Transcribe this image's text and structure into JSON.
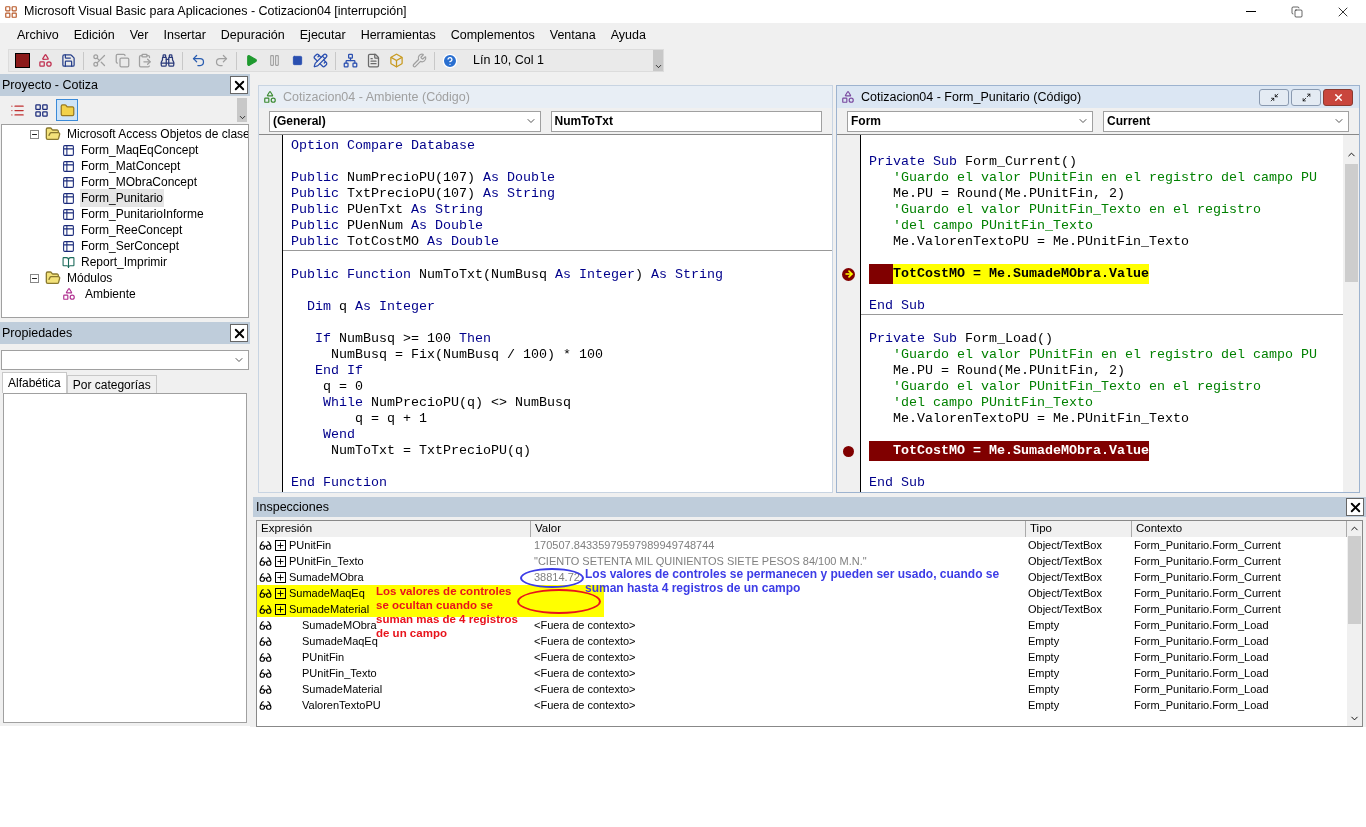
{
  "window": {
    "title": "Microsoft Visual Basic para Aplicaciones - Cotizacion04 [interrupción]"
  },
  "menu": [
    "Archivo",
    "Edición",
    "Ver",
    "Insertar",
    "Depuración",
    "Ejecutar",
    "Herramientas",
    "Complementos",
    "Ventana",
    "Ayuda"
  ],
  "toolbar": {
    "position": "Lín 10, Col 1"
  },
  "project": {
    "title": "Proyecto - Cotiza",
    "tree": [
      {
        "label": "Microsoft Access Objetos de clase",
        "kind": "folder",
        "expanded": true,
        "selected": false,
        "children": [
          {
            "label": "Form_MaqEqConcept",
            "kind": "form",
            "selected": false
          },
          {
            "label": "Form_MatConcept",
            "kind": "form",
            "selected": false
          },
          {
            "label": "Form_MObraConcept",
            "kind": "form",
            "selected": false
          },
          {
            "label": "Form_Punitario",
            "kind": "form",
            "selected": true
          },
          {
            "label": "Form_PunitarioInforme",
            "kind": "form",
            "selected": false
          },
          {
            "label": "Form_ReeConcept",
            "kind": "form",
            "selected": false
          },
          {
            "label": "Form_SerConcept",
            "kind": "form",
            "selected": false
          },
          {
            "label": "Report_Imprimir",
            "kind": "report",
            "selected": false
          }
        ]
      },
      {
        "label": "Módulos",
        "kind": "folder",
        "expanded": true,
        "selected": false,
        "children": [
          {
            "label": "Ambiente",
            "kind": "module",
            "selected": false
          }
        ]
      }
    ]
  },
  "properties": {
    "title": "Propiedades",
    "tabs": [
      {
        "label": "Alfabética",
        "selected": true
      },
      {
        "label": "Por categorías",
        "selected": false
      }
    ]
  },
  "code_windows": [
    {
      "title": "Cotizacion04 - Ambiente (Código)",
      "active": false,
      "object": "(General)",
      "procedure": "NumToTxt",
      "procedures": [
        {
          "lines": [
            {
              "kind": "code",
              "segments": [
                {
                  "kind": "keyword",
                  "text": "Option Compare Database"
                }
              ]
            },
            {
              "kind": "blank"
            },
            {
              "kind": "code",
              "segments": [
                {
                  "kind": "keyword",
                  "text": "Public "
                },
                {
                  "kind": "plain",
                  "text": "NumPrecioPU(107) "
                },
                {
                  "kind": "keyword",
                  "text": "As Double"
                }
              ]
            },
            {
              "kind": "code",
              "segments": [
                {
                  "kind": "keyword",
                  "text": "Public "
                },
                {
                  "kind": "plain",
                  "text": "TxtPrecioPU(107) "
                },
                {
                  "kind": "keyword",
                  "text": "As String"
                }
              ]
            },
            {
              "kind": "code",
              "segments": [
                {
                  "kind": "keyword",
                  "text": "Public "
                },
                {
                  "kind": "plain",
                  "text": "PUenTxt "
                },
                {
                  "kind": "keyword",
                  "text": "As String"
                }
              ]
            },
            {
              "kind": "code",
              "segments": [
                {
                  "kind": "keyword",
                  "text": "Public "
                },
                {
                  "kind": "plain",
                  "text": "PUenNum "
                },
                {
                  "kind": "keyword",
                  "text": "As Double"
                }
              ]
            },
            {
              "kind": "code",
              "segments": [
                {
                  "kind": "keyword",
                  "text": "Public "
                },
                {
                  "kind": "plain",
                  "text": "TotCostMO "
                },
                {
                  "kind": "keyword",
                  "text": "As Double"
                }
              ]
            }
          ]
        },
        {
          "lines": [
            {
              "kind": "blank"
            },
            {
              "kind": "code",
              "segments": [
                {
                  "kind": "keyword",
                  "text": "Public Function "
                },
                {
                  "kind": "plain",
                  "text": "NumToTxt(NumBusq "
                },
                {
                  "kind": "keyword",
                  "text": "As Integer"
                },
                {
                  "kind": "plain",
                  "text": ") "
                },
                {
                  "kind": "keyword",
                  "text": "As String"
                }
              ]
            },
            {
              "kind": "blank"
            },
            {
              "kind": "code",
              "segments": [
                {
                  "kind": "keyword",
                  "text": "  Dim "
                },
                {
                  "kind": "plain",
                  "text": "q "
                },
                {
                  "kind": "keyword",
                  "text": "As Integer"
                }
              ]
            },
            {
              "kind": "blank"
            },
            {
              "kind": "code",
              "segments": [
                {
                  "kind": "keyword",
                  "text": "   If "
                },
                {
                  "kind": "plain",
                  "text": "NumBusq >= 100 "
                },
                {
                  "kind": "keyword",
                  "text": "Then"
                }
              ]
            },
            {
              "kind": "code",
              "segments": [
                {
                  "kind": "plain",
                  "text": "     NumBusq = Fix(NumBusq / 100) * 100"
                }
              ]
            },
            {
              "kind": "code",
              "segments": [
                {
                  "kind": "keyword",
                  "text": "   End If"
                }
              ]
            },
            {
              "kind": "code",
              "segments": [
                {
                  "kind": "plain",
                  "text": "    q = 0"
                }
              ]
            },
            {
              "kind": "code",
              "segments": [
                {
                  "kind": "keyword",
                  "text": "    While "
                },
                {
                  "kind": "plain",
                  "text": "NumPrecioPU(q) <> NumBusq"
                }
              ]
            },
            {
              "kind": "code",
              "segments": [
                {
                  "kind": "plain",
                  "text": "        q = q + 1"
                }
              ]
            },
            {
              "kind": "code",
              "segments": [
                {
                  "kind": "keyword",
                  "text": "    Wend"
                }
              ]
            },
            {
              "kind": "code",
              "segments": [
                {
                  "kind": "plain",
                  "text": "     NumToTxt = TxtPrecioPU(q)"
                }
              ]
            },
            {
              "kind": "blank"
            },
            {
              "kind": "code",
              "segments": [
                {
                  "kind": "keyword",
                  "text": "End Function"
                }
              ]
            }
          ]
        }
      ]
    },
    {
      "title": "Cotizacion04 - Form_Punitario (Código)",
      "active": true,
      "object": "Form",
      "procedure": "Current",
      "procedures": [
        {
          "lines": [
            {
              "kind": "blank"
            },
            {
              "kind": "code",
              "segments": [
                {
                  "kind": "keyword",
                  "text": "Private Sub "
                },
                {
                  "kind": "plain",
                  "text": "Form_Current()"
                }
              ]
            },
            {
              "kind": "code",
              "segments": [
                {
                  "kind": "comment",
                  "text": "   'Guardo el valor PUnitFin en el registro del campo PU"
                }
              ]
            },
            {
              "kind": "code",
              "segments": [
                {
                  "kind": "plain",
                  "text": "   Me.PU = Round(Me.PUnitFin, 2)"
                }
              ]
            },
            {
              "kind": "code",
              "segments": [
                {
                  "kind": "comment",
                  "text": "   'Guardo el valor PUnitFin_Texto en el registro"
                }
              ]
            },
            {
              "kind": "code",
              "segments": [
                {
                  "kind": "comment",
                  "text": "   'del campo PUnitFin_Texto"
                }
              ]
            },
            {
              "kind": "code",
              "segments": [
                {
                  "kind": "plain",
                  "text": "   Me.ValorenTextoPU = Me.PUnitFin_Texto"
                }
              ]
            },
            {
              "kind": "blank"
            },
            {
              "kind": "code",
              "segments": [
                {
                  "kind": "plain",
                  "text": "   TotCostMO = Me.SumadeMObra.Value"
                }
              ],
              "breakpoint": true,
              "current": true
            },
            {
              "kind": "blank"
            },
            {
              "kind": "code",
              "segments": [
                {
                  "kind": "keyword",
                  "text": "End Sub"
                }
              ]
            }
          ]
        },
        {
          "lines": [
            {
              "kind": "blank"
            },
            {
              "kind": "code",
              "segments": [
                {
                  "kind": "keyword",
                  "text": "Private Sub "
                },
                {
                  "kind": "plain",
                  "text": "Form_Load()"
                }
              ]
            },
            {
              "kind": "code",
              "segments": [
                {
                  "kind": "comment",
                  "text": "   'Guardo el valor PUnitFin en el registro del campo PU"
                }
              ]
            },
            {
              "kind": "code",
              "segments": [
                {
                  "kind": "plain",
                  "text": "   Me.PU = Round(Me.PUnitFin, 2)"
                }
              ]
            },
            {
              "kind": "code",
              "segments": [
                {
                  "kind": "comment",
                  "text": "   'Guardo el valor PUnitFin_Texto en el registro"
                }
              ]
            },
            {
              "kind": "code",
              "segments": [
                {
                  "kind": "comment",
                  "text": "   'del campo PUnitFin_Texto"
                }
              ]
            },
            {
              "kind": "code",
              "segments": [
                {
                  "kind": "plain",
                  "text": "   Me.ValorenTextoPU = Me.PUnitFin_Texto"
                }
              ]
            },
            {
              "kind": "blank"
            },
            {
              "kind": "code",
              "segments": [
                {
                  "text": "   TotCostMO = Me.SumadeMObra.Value"
                }
              ],
              "breakpoint": true,
              "current": false
            },
            {
              "kind": "blank"
            },
            {
              "kind": "code",
              "segments": [
                {
                  "kind": "keyword",
                  "text": "End Sub"
                }
              ]
            }
          ]
        }
      ]
    }
  ],
  "watches": {
    "title": "Inspecciones",
    "columns": [
      "Expresión",
      "Valor",
      "Tipo",
      "Contexto"
    ],
    "rows": [
      {
        "expression": "PUnitFin",
        "value": "170507.84335979597989949748744",
        "type": "Object/TextBox",
        "context": "Form_Punitario.Form_Current",
        "expandable": true,
        "dimmed": true,
        "highlighted": false
      },
      {
        "expression": "PUnitFin_Texto",
        "value": "\"CIENTO SETENTA MIL QUINIENTOS SIETE PESOS 84/100 M.N.\"",
        "type": "Object/TextBox",
        "context": "Form_Punitario.Form_Current",
        "expandable": true,
        "dimmed": true,
        "highlighted": false
      },
      {
        "expression": "SumadeMObra",
        "value": "38814.72",
        "type": "Object/TextBox",
        "context": "Form_Punitario.Form_Current",
        "expandable": true,
        "dimmed": true,
        "highlighted": false
      },
      {
        "expression": "SumadeMaqEq",
        "type": "Object/TextBox",
        "context": "Form_Punitario.Form_Current",
        "expandable": true,
        "highlighted": true
      },
      {
        "expression": "SumadeMaterial",
        "type": "Object/TextBox",
        "context": "Form_Punitario.Form_Current",
        "expandable": true,
        "highlighted": true
      },
      {
        "expression": "SumadeMObra",
        "value": "<Fuera de contexto>",
        "type": "Empty",
        "context": "Form_Punitario.Form_Load",
        "expandable": false,
        "dimmed": false,
        "highlighted": false
      },
      {
        "expression": "SumadeMaqEq",
        "value": "<Fuera de contexto>",
        "type": "Empty",
        "context": "Form_Punitario.Form_Load",
        "expandable": false,
        "dimmed": false,
        "highlighted": false
      },
      {
        "expression": "PUnitFin",
        "value": "<Fuera de contexto>",
        "type": "Empty",
        "context": "Form_Punitario.Form_Load",
        "expandable": false,
        "dimmed": false,
        "highlighted": false
      },
      {
        "expression": "PUnitFin_Texto",
        "value": "<Fuera de contexto>",
        "type": "Empty",
        "context": "Form_Punitario.Form_Load",
        "expandable": false,
        "dimmed": false,
        "highlighted": false
      },
      {
        "expression": "SumadeMaterial",
        "value": "<Fuera de contexto>",
        "type": "Empty",
        "context": "Form_Punitario.Form_Load",
        "expandable": false,
        "dimmed": false,
        "highlighted": false
      },
      {
        "expression": "ValorenTextoPU",
        "value": "<Fuera de contexto>",
        "type": "Empty",
        "context": "Form_Punitario.Form_Load",
        "expandable": false,
        "dimmed": false,
        "highlighted": false
      }
    ],
    "annotations": [
      {
        "text": "Los valores de controles se permanecen y pueden ser usado, cuando se suman hasta 4 registros de un campo",
        "color": "#3c3ce6"
      },
      {
        "text": "Los valores de controles se ocultan cuando se suman mas de 4 registros de un campo",
        "color": "#e8141c"
      }
    ]
  }
}
